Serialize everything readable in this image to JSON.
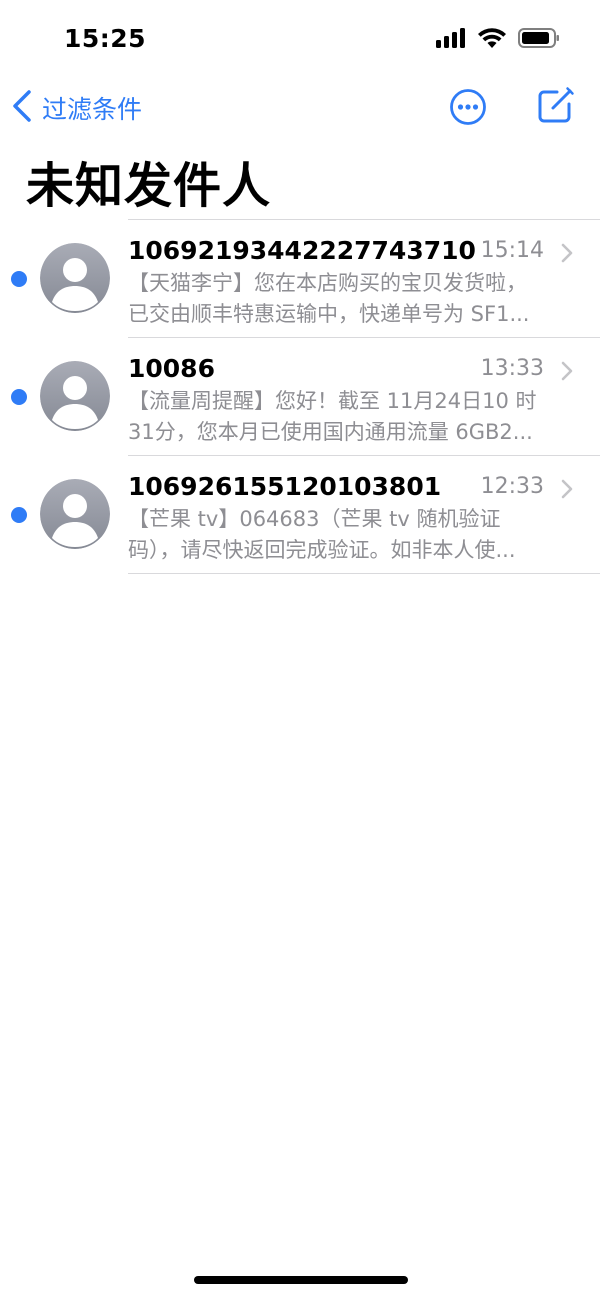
{
  "status_bar": {
    "time": "15:25",
    "icons": [
      "cellular-signal-icon",
      "wifi-icon",
      "battery-icon"
    ]
  },
  "nav": {
    "back_label": "过滤条件",
    "back_icon": "chevron-left-icon",
    "more_icon": "ellipsis-circle-icon",
    "compose_icon": "compose-icon"
  },
  "title": "未知发件人",
  "colors": {
    "accent": "#2f7cf6",
    "secondary_text": "#8e8e93",
    "unread_dot": "#2f7cf6"
  },
  "messages": [
    {
      "sender": "10692193442227743710",
      "time": "15:14",
      "unread": true,
      "preview_line1": "【天猫李宁】您在本店购买的宝贝发货啦，",
      "preview_line2": "已交由顺丰特惠运输中，快递单号为 SF1..."
    },
    {
      "sender": "10086",
      "time": "13:33",
      "unread": true,
      "preview_line1": "【流量周提醒】您好！截至 11月24日10 时",
      "preview_line2": "31分，您本月已使用国内通用流量 6GB2..."
    },
    {
      "sender": "106926155120103801",
      "time": "12:33",
      "unread": true,
      "preview_line1": "【芒果 tv】064683（芒果 tv 随机验证",
      "preview_line2": "码），请尽快返回完成验证。如非本人使..."
    }
  ]
}
